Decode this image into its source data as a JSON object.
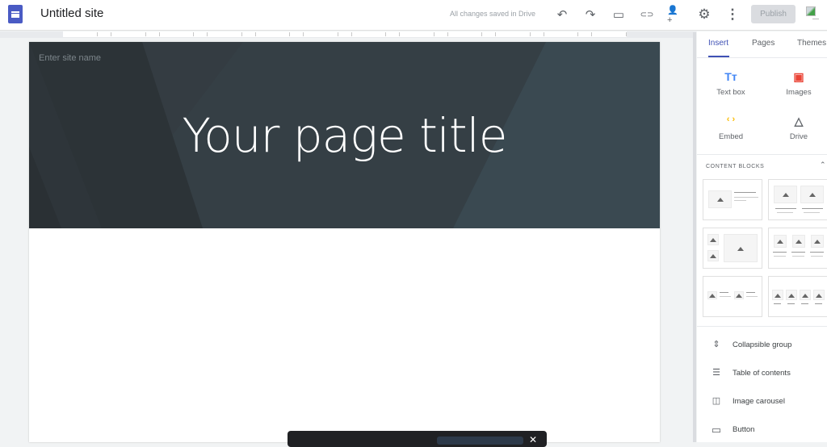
{
  "header": {
    "app_icon": "google-sites-icon",
    "site_title": "Untitled site",
    "save_status": "All changes saved in Drive",
    "toolbar": [
      {
        "name": "undo",
        "icon": "undo-icon",
        "glyph": "↶"
      },
      {
        "name": "redo",
        "icon": "redo-icon",
        "glyph": "↷"
      },
      {
        "name": "preview",
        "icon": "preview-devices-icon",
        "glyph": "▭"
      },
      {
        "name": "copy-link",
        "icon": "link-icon",
        "glyph": "⊂⊃"
      },
      {
        "name": "share",
        "icon": "add-person-icon",
        "glyph": "👤+"
      },
      {
        "name": "settings",
        "icon": "gear-icon",
        "glyph": "⚙"
      },
      {
        "name": "more",
        "icon": "more-vert-icon",
        "glyph": "⋮"
      }
    ],
    "publish_label": "Publish",
    "avatar": "account-avatar"
  },
  "page": {
    "site_name_placeholder": "Enter site name",
    "title": "Your page title"
  },
  "panel": {
    "tabs": [
      {
        "label": "Insert",
        "active": true
      },
      {
        "label": "Pages",
        "active": false
      },
      {
        "label": "Themes",
        "active": false
      }
    ],
    "insert_items": [
      {
        "label": "Text box",
        "icon": "text-box-icon",
        "glyph": "Tт",
        "color": "#4285f4"
      },
      {
        "label": "Images",
        "icon": "image-icon",
        "glyph": "▣",
        "color": "#ea4335"
      },
      {
        "label": "Embed",
        "icon": "embed-code-icon",
        "glyph": "‹ ›",
        "color": "#fbbc04"
      },
      {
        "label": "Drive",
        "icon": "drive-icon",
        "glyph": "△",
        "color": "#5f6368"
      }
    ],
    "content_blocks_title": "CONTENT BLOCKS",
    "content_block_count": 6,
    "components": [
      {
        "label": "Collapsible group",
        "icon": "collapsible-group-icon",
        "glyph": "⇕"
      },
      {
        "label": "Table of contents",
        "icon": "table-of-contents-icon",
        "glyph": "☰"
      },
      {
        "label": "Image carousel",
        "icon": "image-carousel-icon",
        "glyph": "◫"
      },
      {
        "label": "Button",
        "icon": "button-icon",
        "glyph": "▭"
      }
    ]
  },
  "colors": {
    "accent": "#3f51b5",
    "hero_bg": "#2f373c",
    "publish_disabled_bg": "#dadce0"
  }
}
